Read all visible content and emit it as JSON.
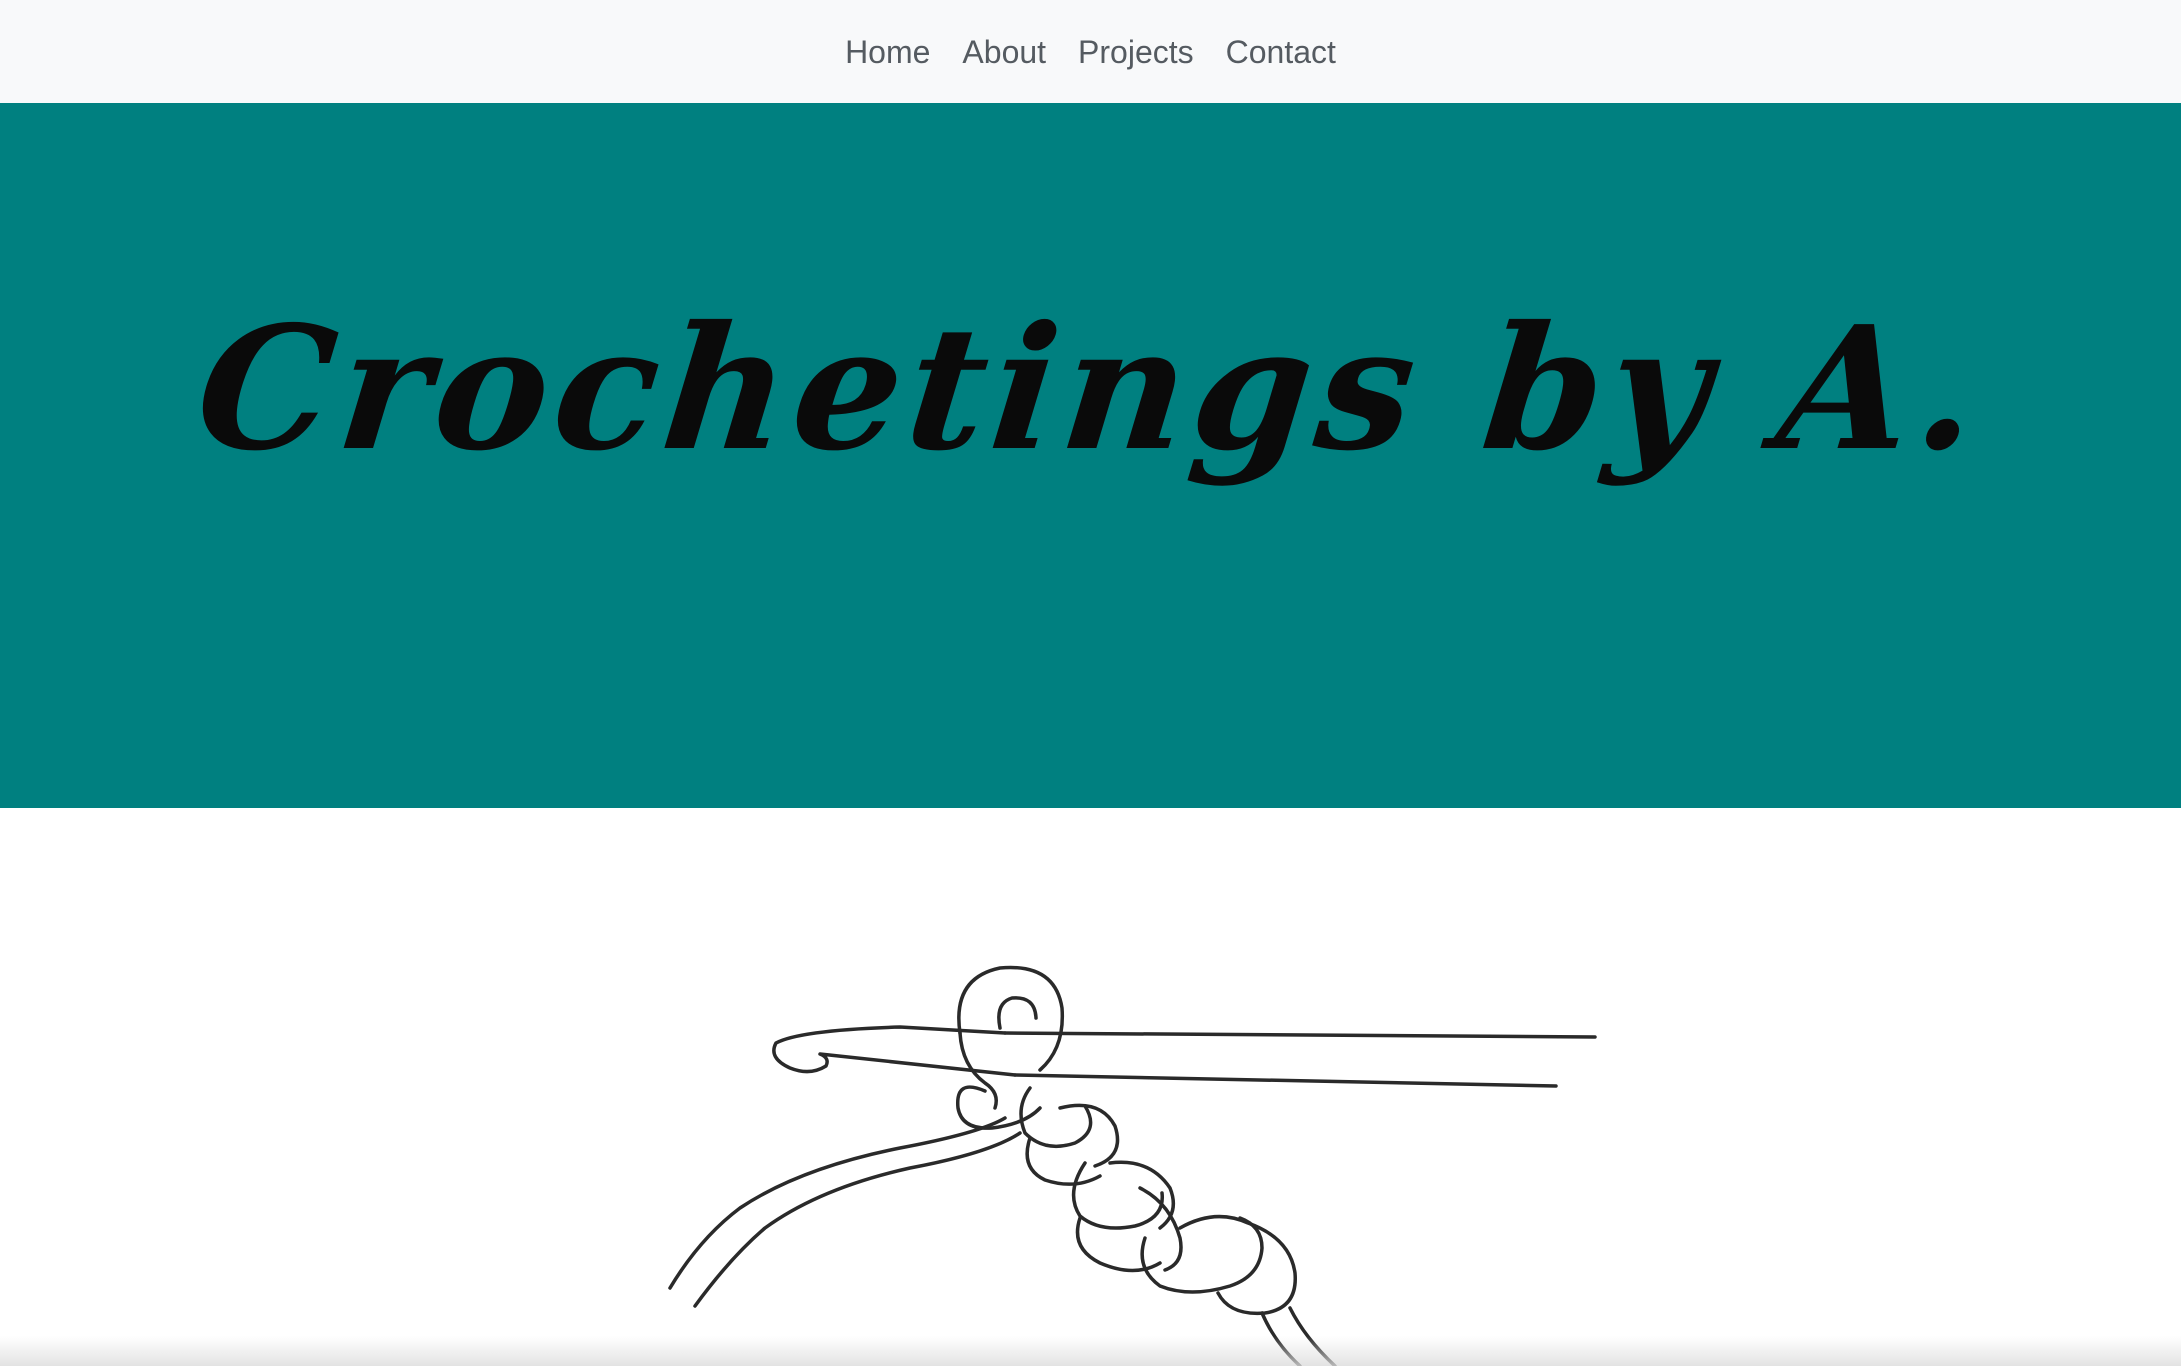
{
  "nav": {
    "items": [
      {
        "label": "Home"
      },
      {
        "label": "About"
      },
      {
        "label": "Projects"
      },
      {
        "label": "Contact"
      }
    ]
  },
  "hero": {
    "title": "Crochetings by A.",
    "background": "#008080"
  },
  "illustration": {
    "icon": "crochet-hook-chain-illustration-icon"
  },
  "colors": {
    "navbar_bg": "#f8f9fa",
    "nav_text": "#555b61",
    "hero_bg": "#008080",
    "title_text": "#0a0a0a"
  }
}
